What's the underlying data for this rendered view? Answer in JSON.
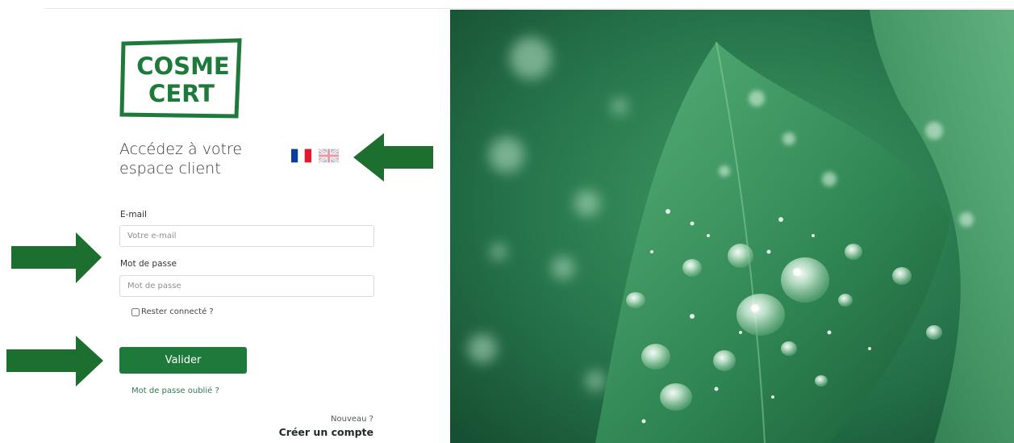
{
  "brand": {
    "logo_line1": "COSME",
    "logo_line2": "CERT",
    "color": "#1e7a3a"
  },
  "header": {
    "title_line1": "Accédez à votre",
    "title_line2": "espace client"
  },
  "languages": [
    {
      "code": "fr",
      "icon": "french-flag-icon"
    },
    {
      "code": "en",
      "icon": "uk-flag-icon"
    }
  ],
  "form": {
    "email_label": "E-mail",
    "email_placeholder": "Votre e-mail",
    "email_value": "",
    "password_label": "Mot de passe",
    "password_placeholder": "Mot de passe",
    "password_value": "",
    "remember_label": "Rester connecté ?",
    "remember_checked": false,
    "submit_label": "Valider",
    "forgot_label": "Mot de passe oublié ?"
  },
  "signup": {
    "prompt": "Nouveau ?",
    "link_label": "Créer un compte"
  },
  "annotations": {
    "arrow_color": "#1c6f2f",
    "arrows": [
      "arrow-to-language-flags",
      "arrow-to-login-fields",
      "arrow-to-submit-button"
    ]
  },
  "hero": {
    "icon": "water-droplets-on-leaf-photo"
  }
}
